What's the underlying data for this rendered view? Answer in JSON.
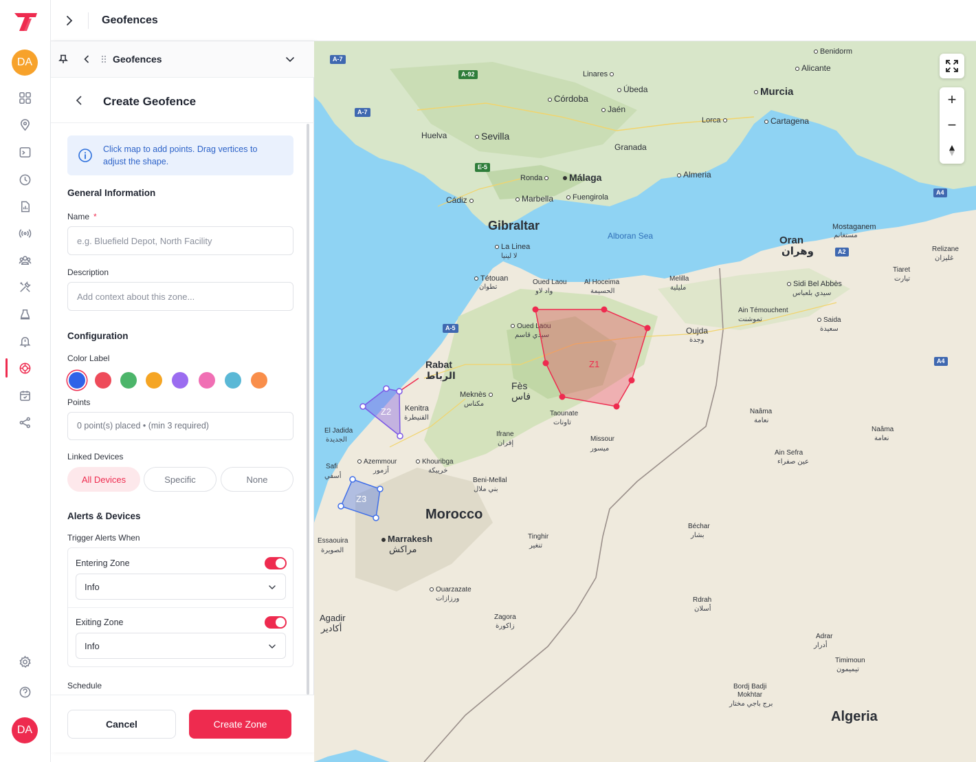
{
  "topbar": {
    "title": "Geofences"
  },
  "rail": {
    "avatar_initials": "DA",
    "user_initials": "DA",
    "icons": [
      "dashboard-icon",
      "location-pin-icon",
      "screen-icon",
      "clock-icon",
      "report-icon",
      "signal-icon",
      "users-icon",
      "tools-icon",
      "alarm-icon",
      "alert-bell-icon",
      "geofence-icon",
      "calendar-icon",
      "share-icon",
      "settings-icon",
      "help-icon"
    ]
  },
  "panel": {
    "header_title": "Geofences",
    "create_title": "Create Geofence",
    "info_text": "Click map to add points. Drag vertices to adjust the shape.",
    "general_title": "General Information",
    "name_label": "Name",
    "name_required": "*",
    "name_placeholder": "e.g. Bluefield Depot, North Facility",
    "description_label": "Description",
    "description_placeholder": "Add context about this zone...",
    "config_title": "Configuration",
    "color_label": "Color Label",
    "colors": [
      "#2f63e8",
      "#ee4b5a",
      "#4cb56a",
      "#f5a524",
      "#9b6cf0",
      "#f06fb4",
      "#5ab8d6",
      "#f98e4a"
    ],
    "points_label": "Points",
    "points_text": "0 point(s) placed • (min 3 required)",
    "linked_label": "Linked Devices",
    "linked_options": [
      "All Devices",
      "Specific",
      "None"
    ],
    "alerts_title": "Alerts & Devices",
    "trigger_label": "Trigger Alerts When",
    "entering_label": "Entering Zone",
    "entering_value": "Info",
    "exiting_label": "Exiting Zone",
    "exiting_value": "Info",
    "schedule_label": "Schedule",
    "cancel_label": "Cancel",
    "create_label": "Create Zone"
  },
  "map": {
    "places": {
      "benidorm": "Benidorm",
      "alicante": "Alicante",
      "linares": "Linares",
      "ubeda": "Úbeda",
      "cordoba": "Córdoba",
      "jaen": "Jaén",
      "murcia": "Murcia",
      "lorca": "Lorca",
      "cartagena": "Cartagena",
      "huelva": "Huelva",
      "sevilla": "Sevilla",
      "granada": "Granada",
      "ronda": "Ronda",
      "malaga": "Málaga",
      "almeria": "Almeria",
      "cadiz": "Cádiz",
      "marbella": "Marbella",
      "fuengirola": "Fuengirola",
      "gibraltar": "Gibraltar",
      "alboran": "Alboran Sea",
      "lalinea": "La Linea",
      "lalinea_ar": "لا لينيا",
      "mostaganem": "Mostaganem",
      "mostaganem_ar": "مستغانم",
      "oran": "Oran",
      "oran_ar": "وهران",
      "relizane": "Relizane",
      "relizane_ar": "غليزان",
      "tiaret": "Tiaret",
      "tiaret_ar": "تيارت",
      "tetouan": "Tétouan",
      "tetouan_ar": "تطوان",
      "ouedlaou1": "Oued Laou",
      "ouedlaou1_ar": "واد لاو",
      "alhoceima": "Al Hoceima",
      "alhoceima_ar": "الحسيمة",
      "melilla": "Melilla",
      "melilla_ar": "مليلية",
      "sidibel": "Sidi Bel Abbès",
      "sidibel_ar": "سيدي بلعباس",
      "aintem": "Ain Témouchent",
      "aintem_ar": "تموشنت",
      "saida": "Saida",
      "saida_ar": "سعيدة",
      "ouedlaou2": "Oued Laou",
      "ouedlaou2_ar": "سيدي قاسم",
      "oujda": "Oujda",
      "oujda_ar": "وجدة",
      "rabat": "Rabat",
      "rabat_ar": "الرباط",
      "kenitra": "Kenitra",
      "kenitra_ar": "القنيطرة",
      "meknes": "Meknès",
      "meknes_ar": "مكناس",
      "fes": "Fès",
      "fes_ar": "فاس",
      "taounate": "Taounate",
      "taounate_ar": "تاونات",
      "eljadida": "El Jadida",
      "eljadida_ar": "الجديدة",
      "ifrane": "Ifrane",
      "ifrane_ar": "إفران",
      "missour": "Missour",
      "missour_ar": "ميسور",
      "naama1": "Naâma",
      "naama1_ar": "نعامة",
      "naama2": "Naâma",
      "naama2_ar": "نعامة",
      "safi": "Safi",
      "safi_ar": "أسفي",
      "azemmour": "Azemmour",
      "azemmour_ar": "أزمور",
      "khouribga": "Khouribga",
      "khouribga_ar": "خريبكة",
      "ainsefra": "Ain Sefra",
      "ainsefra_ar": "عين صفراء",
      "benimellal": "Beni-Mellal",
      "benimellal_ar": "بني ملال",
      "morocco": "Morocco",
      "essaouira": "Essaouira",
      "essaouira_ar": "الصويرة",
      "marrakesh": "Marrakesh",
      "marrakesh_ar": "مراكش",
      "tinghir": "Tinghir",
      "tinghir_ar": "تنغير",
      "bechar": "Béchar",
      "bechar_ar": "بشار",
      "ouarzazate": "Ouarzazate",
      "ouarzazate_ar": "ورزازات",
      "rdrah": "Rdrah",
      "rdrah_ar": "أسلان",
      "agadir": "Agadir",
      "agadir_ar": "أكادير",
      "zagora": "Zagora",
      "zagora_ar": "زاكورة",
      "adrar": "Adrar",
      "adrar_ar": "أدرار",
      "timimoun": "Timimoun",
      "timimoun_ar": "تيميمون",
      "bordj1": "Bordj Badji",
      "bordj2": "Mokhtar",
      "bordj_ar": "برج باجي مختار",
      "algeria": "Algeria"
    },
    "roads": {
      "a7a": "A-7",
      "a92": "A-92",
      "a7b": "A-7",
      "e5": "E-5",
      "a4a": "A4",
      "a2": "A2",
      "a5": "A-5",
      "a4b": "A4"
    },
    "zones": [
      {
        "label": "Z1",
        "color": "#ee2b4f"
      },
      {
        "label": "Z2",
        "color": "#7b57e6"
      },
      {
        "label": "Z3",
        "color": "#3f6ee8"
      }
    ],
    "controls": {
      "zoom_in": "+",
      "zoom_out": "−"
    }
  }
}
